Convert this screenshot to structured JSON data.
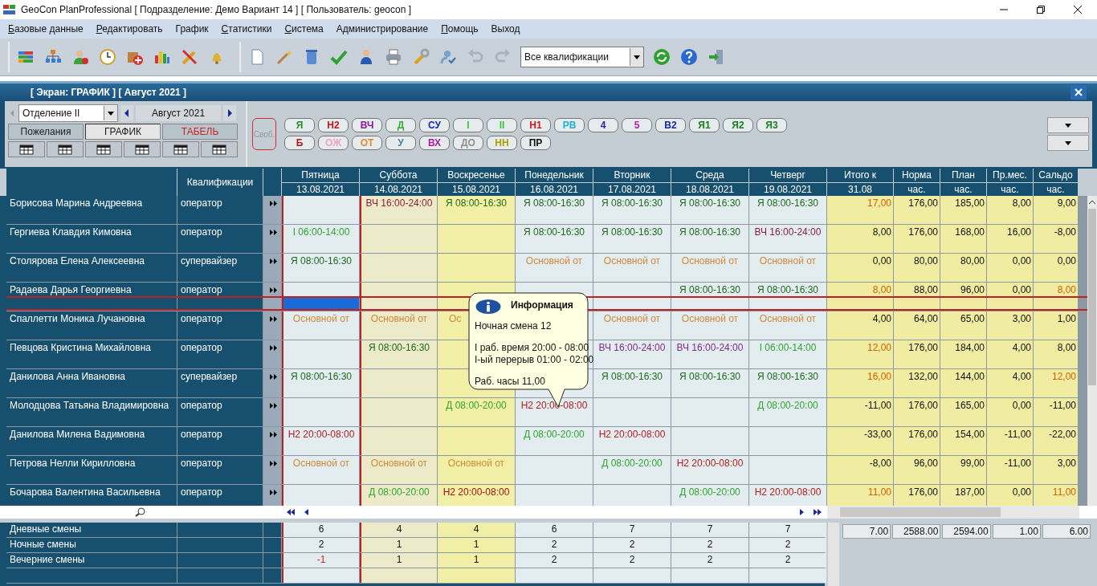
{
  "window": {
    "title": "GeoCon PlanProfessional [ Подразделение: Демо Вариант 14 ] [ Пользователь: geocon ]"
  },
  "menu": [
    {
      "label": "Базовые данные",
      "mnemonic": true
    },
    {
      "label": "Редактировать",
      "mnemonic": true
    },
    {
      "label": "График",
      "mnemonic": false
    },
    {
      "label": "Статистики",
      "mnemonic": true
    },
    {
      "label": "Система",
      "mnemonic": true
    },
    {
      "label": "Администрирование",
      "mnemonic": false
    },
    {
      "label": "Помощь",
      "mnemonic": true
    },
    {
      "label": "Выход",
      "mnemonic": false
    }
  ],
  "toolbar": {
    "qualification_select": "Все квалификации"
  },
  "screen": {
    "title": "[ Экран: ГРАФИК ] [ Август 2021 ]"
  },
  "department_select": "Отделение II",
  "month": "Август 2021",
  "view_tabs": [
    {
      "label": "Пожелания",
      "selected": false,
      "color": "#1a1a1a"
    },
    {
      "label": "ГРАФИК",
      "selected": true,
      "color": "#1a1a1a"
    },
    {
      "label": "ТАБЕЛЬ",
      "selected": false,
      "color": "#d02020"
    }
  ],
  "free_button": "Своб.",
  "shift_codes": [
    [
      {
        "code": "Я",
        "color": "#2a8a2a"
      },
      {
        "code": "Н2",
        "color": "#c01818"
      },
      {
        "code": "ВЧ",
        "color": "#8a1a9a"
      },
      {
        "code": "Д",
        "color": "#30b030"
      },
      {
        "code": "СУ",
        "color": "#1a2ab0"
      },
      {
        "code": "I",
        "color": "#40c040"
      },
      {
        "code": "II",
        "color": "#40c040"
      },
      {
        "code": "Н1",
        "color": "#d01818"
      },
      {
        "code": "РВ",
        "color": "#20b0d0"
      },
      {
        "code": "4",
        "color": "#1a2a9a"
      },
      {
        "code": "5",
        "color": "#b020b0"
      },
      {
        "code": "В2",
        "color": "#1a2a9a"
      },
      {
        "code": "Я1",
        "color": "#1e7a1e"
      },
      {
        "code": "Я2",
        "color": "#1e7a1e"
      },
      {
        "code": "Я3",
        "color": "#1e7a1e"
      }
    ],
    [
      {
        "code": "Б",
        "color": "#b01818"
      },
      {
        "code": "ОЖ",
        "color": "#f0a0c0"
      },
      {
        "code": "ОТ",
        "color": "#e08a30"
      },
      {
        "code": "У",
        "color": "#5080a0"
      },
      {
        "code": "ВХ",
        "color": "#b020a0"
      },
      {
        "code": "ДО",
        "color": "#909090"
      },
      {
        "code": "НН",
        "color": "#a8a000"
      },
      {
        "code": "ПР",
        "color": "#101010"
      }
    ]
  ],
  "qualification_header": "Квалификации",
  "days": [
    {
      "day": "Пятница",
      "date": "13.08.2021",
      "kind": "weekday"
    },
    {
      "day": "Суббота",
      "date": "14.08.2021",
      "kind": "saturday"
    },
    {
      "day": "Воскресенье",
      "date": "15.08.2021",
      "kind": "sunday"
    },
    {
      "day": "Понедельник",
      "date": "16.08.2021",
      "kind": "weekday"
    },
    {
      "day": "Вторник",
      "date": "17.08.2021",
      "kind": "weekday"
    },
    {
      "day": "Среда",
      "date": "18.08.2021",
      "kind": "weekday"
    },
    {
      "day": "Четверг",
      "date": "19.08.2021",
      "kind": "weekday"
    }
  ],
  "total_columns": [
    {
      "title": "Итого к",
      "unit": "31.08"
    },
    {
      "title": "Норма",
      "unit": "час."
    },
    {
      "title": "План",
      "unit": "час."
    },
    {
      "title": "Пр.мес.",
      "unit": "час."
    },
    {
      "title": "Сальдо",
      "unit": "час."
    }
  ],
  "rows": [
    {
      "name": "Борисова Марина Андреевна",
      "qualification": "оператор",
      "selected": false,
      "cells": [
        null,
        {
          "text": "ВЧ 16:00-24:00",
          "color": "#8a1f3a"
        },
        {
          "text": "Я  08:00-16:30",
          "color": "#1e6b1e"
        },
        {
          "text": "Я  08:00-16:30",
          "color": "#1e6b1e"
        },
        {
          "text": "Я  08:00-16:30",
          "color": "#1e6b1e"
        },
        {
          "text": "Я  08:00-16:30",
          "color": "#1e6b1e"
        },
        {
          "text": "Я  08:00-16:30",
          "color": "#1e6b1e"
        }
      ],
      "totals": [
        {
          "text": "17,00",
          "warn": true
        },
        {
          "text": "176,00",
          "warn": false
        },
        {
          "text": "185,00",
          "warn": false
        },
        {
          "text": "8,00",
          "warn": false
        },
        {
          "text": "9,00",
          "warn": false
        }
      ]
    },
    {
      "name": "Гергиева Клавдия Кимовна",
      "qualification": "оператор",
      "selected": false,
      "cells": [
        {
          "text": "I  06:00-14:00",
          "color": "#2fa52f"
        },
        null,
        null,
        {
          "text": "Я  08:00-16:30",
          "color": "#1e6b1e"
        },
        {
          "text": "Я  08:00-16:30",
          "color": "#1e6b1e"
        },
        {
          "text": "Я  08:00-16:30",
          "color": "#1e6b1e"
        },
        {
          "text": "ВЧ 16:00-24:00",
          "color": "#8a1f3a"
        }
      ],
      "totals": [
        {
          "text": "8,00",
          "warn": false
        },
        {
          "text": "176,00",
          "warn": false
        },
        {
          "text": "168,00",
          "warn": false
        },
        {
          "text": "16,00",
          "warn": false
        },
        {
          "text": "-8,00",
          "warn": false
        }
      ]
    },
    {
      "name": "Столярова Елена Алексеевна",
      "qualification": "супервайзер",
      "selected": false,
      "cells": [
        {
          "text": "Я  08:00-16:30",
          "color": "#1e6b1e"
        },
        null,
        null,
        {
          "text": "Основной от",
          "color": "#d08a3a"
        },
        {
          "text": "Основной от",
          "color": "#d08a3a"
        },
        {
          "text": "Основной от",
          "color": "#d08a3a"
        },
        {
          "text": "Основной от",
          "color": "#d08a3a"
        }
      ],
      "totals": [
        {
          "text": "0,00",
          "warn": false
        },
        {
          "text": "80,00",
          "warn": false
        },
        {
          "text": "80,00",
          "warn": false
        },
        {
          "text": "0,00",
          "warn": false
        },
        {
          "text": "0,00",
          "warn": false
        }
      ]
    },
    {
      "name": "Радаева Дарья Георгиевна",
      "qualification": "оператор",
      "selected": true,
      "cells": [
        null,
        null,
        null,
        null,
        null,
        {
          "text": "Я  08:00-16:30",
          "color": "#1e6b1e"
        },
        {
          "text": "Я  08:00-16:30",
          "color": "#1e6b1e"
        }
      ],
      "totals": [
        {
          "text": "8,00",
          "warn": true
        },
        {
          "text": "88,00",
          "warn": false
        },
        {
          "text": "96,00",
          "warn": false
        },
        {
          "text": "0,00",
          "warn": false
        },
        {
          "text": "8,00",
          "warn": true
        }
      ]
    },
    {
      "name": "Спаллетти Моника Лучановна",
      "qualification": "оператор",
      "selected": false,
      "cells": [
        {
          "text": "Основной от",
          "color": "#d08a3a"
        },
        {
          "text": "Основной от",
          "color": "#d08a3a"
        },
        {
          "text": "Ос",
          "color": "#d08a3a",
          "cut": true
        },
        null,
        {
          "text": "Основной от",
          "color": "#d08a3a"
        },
        {
          "text": "Основной от",
          "color": "#d08a3a"
        },
        {
          "text": "Основной от",
          "color": "#d08a3a"
        }
      ],
      "totals": [
        {
          "text": "4,00",
          "warn": false
        },
        {
          "text": "64,00",
          "warn": false
        },
        {
          "text": "65,00",
          "warn": false
        },
        {
          "text": "3,00",
          "warn": false
        },
        {
          "text": "1,00",
          "warn": false
        }
      ]
    },
    {
      "name": "Певцова Кристина Михайловна",
      "qualification": "оператор",
      "selected": false,
      "cells": [
        null,
        {
          "text": "Я  08:00-16:30",
          "color": "#1e6b1e"
        },
        null,
        null,
        {
          "text": "ВЧ 16:00-24:00",
          "color": "#7d2a8c"
        },
        {
          "text": "ВЧ 16:00-24:00",
          "color": "#7d2a8c"
        },
        {
          "text": "I  06:00-14:00",
          "color": "#2fa52f"
        }
      ],
      "totals": [
        {
          "text": "12,00",
          "warn": true
        },
        {
          "text": "176,00",
          "warn": false
        },
        {
          "text": "184,00",
          "warn": false
        },
        {
          "text": "4,00",
          "warn": false
        },
        {
          "text": "8,00",
          "warn": false
        }
      ]
    },
    {
      "name": "Данилова Анна Ивановна",
      "qualification": "супервайзер",
      "selected": false,
      "cells": [
        {
          "text": "Я  08:00-16:30",
          "color": "#1e6b1e"
        },
        null,
        null,
        null,
        {
          "text": "Я  08:00-16:30",
          "color": "#1e6b1e"
        },
        {
          "text": "Я  08:00-16:30",
          "color": "#1e6b1e"
        },
        {
          "text": "Я  08:00-16:30",
          "color": "#1e6b1e"
        }
      ],
      "totals": [
        {
          "text": "16,00",
          "warn": true
        },
        {
          "text": "132,00",
          "warn": false
        },
        {
          "text": "144,00",
          "warn": false
        },
        {
          "text": "4,00",
          "warn": false
        },
        {
          "text": "12,00",
          "warn": true
        }
      ]
    },
    {
      "name": "Молодцова Татьяна Владимировна",
      "qualification": "оператор",
      "selected": false,
      "cells": [
        null,
        null,
        {
          "text": "Д  08:00-20:00",
          "color": "#2fa52f"
        },
        {
          "text": "Н2 20:00-08:00",
          "color": "#b01c1c"
        },
        null,
        null,
        {
          "text": "Д  08:00-20:00",
          "color": "#2fa52f"
        }
      ],
      "totals": [
        {
          "text": "-11,00",
          "warn": false
        },
        {
          "text": "176,00",
          "warn": false
        },
        {
          "text": "165,00",
          "warn": false
        },
        {
          "text": "0,00",
          "warn": false
        },
        {
          "text": "-11,00",
          "warn": false
        }
      ]
    },
    {
      "name": "Данилова Милена Вадимовна",
      "qualification": "оператор",
      "selected": false,
      "cells": [
        {
          "text": "Н2 20:00-08:00",
          "color": "#b01c1c"
        },
        null,
        null,
        {
          "text": "Д  08:00-20:00",
          "color": "#2fa52f"
        },
        {
          "text": "Н2 20:00-08:00",
          "color": "#b01c1c"
        },
        null,
        null
      ],
      "totals": [
        {
          "text": "-33,00",
          "warn": false
        },
        {
          "text": "176,00",
          "warn": false
        },
        {
          "text": "154,00",
          "warn": false
        },
        {
          "text": "-11,00",
          "warn": false
        },
        {
          "text": "-22,00",
          "warn": false
        }
      ]
    },
    {
      "name": "Петрова Нелли Кирилловна",
      "qualification": "оператор",
      "selected": false,
      "cells": [
        {
          "text": "Основной от",
          "color": "#d08a3a"
        },
        {
          "text": "Основной от",
          "color": "#d08a3a"
        },
        {
          "text": "Основной от",
          "color": "#d08a3a"
        },
        null,
        {
          "text": "Д  08:00-20:00",
          "color": "#2fa52f"
        },
        {
          "text": "Н2 20:00-08:00",
          "color": "#b01c1c"
        },
        null
      ],
      "totals": [
        {
          "text": "-8,00",
          "warn": false
        },
        {
          "text": "96,00",
          "warn": false
        },
        {
          "text": "99,00",
          "warn": false
        },
        {
          "text": "-11,00",
          "warn": false
        },
        {
          "text": "3,00",
          "warn": false
        }
      ]
    },
    {
      "name": "Бочарова Валентина Васильевна",
      "qualification": "оператор",
      "selected": false,
      "cells": [
        null,
        {
          "text": "Д  08:00-20:00",
          "color": "#2fa52f"
        },
        {
          "text": "Н2 20:00-08:00",
          "color": "#a01010"
        },
        null,
        null,
        {
          "text": "Д  08:00-20:00",
          "color": "#2fa52f"
        },
        {
          "text": "Н2 20:00-08:00",
          "color": "#b01c1c"
        }
      ],
      "totals": [
        {
          "text": "11,00",
          "warn": true
        },
        {
          "text": "176,00",
          "warn": false
        },
        {
          "text": "187,00",
          "warn": false
        },
        {
          "text": "0,00",
          "warn": false
        },
        {
          "text": "11,00",
          "warn": true
        }
      ]
    }
  ],
  "tooltip": {
    "title": "Информация",
    "lines": [
      "Ночная смена 12",
      "I раб. время 20:00 - 08:00",
      "I-ый перерыв 01:00 - 02:00",
      "Раб. часы 11,00"
    ]
  },
  "summary": {
    "rows": [
      {
        "label": "Дневные смены",
        "values": [
          {
            "text": "6",
            "warn": false
          },
          {
            "text": "4",
            "warn": false
          },
          {
            "text": "4",
            "warn": false
          },
          {
            "text": "6",
            "warn": false
          },
          {
            "text": "7",
            "warn": false
          },
          {
            "text": "7",
            "warn": false
          },
          {
            "text": "7",
            "warn": false
          }
        ]
      },
      {
        "label": "Ночные смены",
        "values": [
          {
            "text": "2",
            "warn": false
          },
          {
            "text": "1",
            "warn": false
          },
          {
            "text": "1",
            "warn": false
          },
          {
            "text": "2",
            "warn": false
          },
          {
            "text": "2",
            "warn": false
          },
          {
            "text": "2",
            "warn": false
          },
          {
            "text": "2",
            "warn": false
          }
        ]
      },
      {
        "label": "Вечерние смены",
        "values": [
          {
            "text": "-1",
            "warn": true
          },
          {
            "text": "1",
            "warn": false
          },
          {
            "text": "1",
            "warn": false
          },
          {
            "text": "2",
            "warn": false
          },
          {
            "text": "2",
            "warn": false
          },
          {
            "text": "2",
            "warn": false
          },
          {
            "text": "2",
            "warn": false
          }
        ]
      }
    ],
    "totals": [
      "7.00",
      "2588.00",
      "2594.00",
      "1.00",
      "6.00"
    ]
  }
}
